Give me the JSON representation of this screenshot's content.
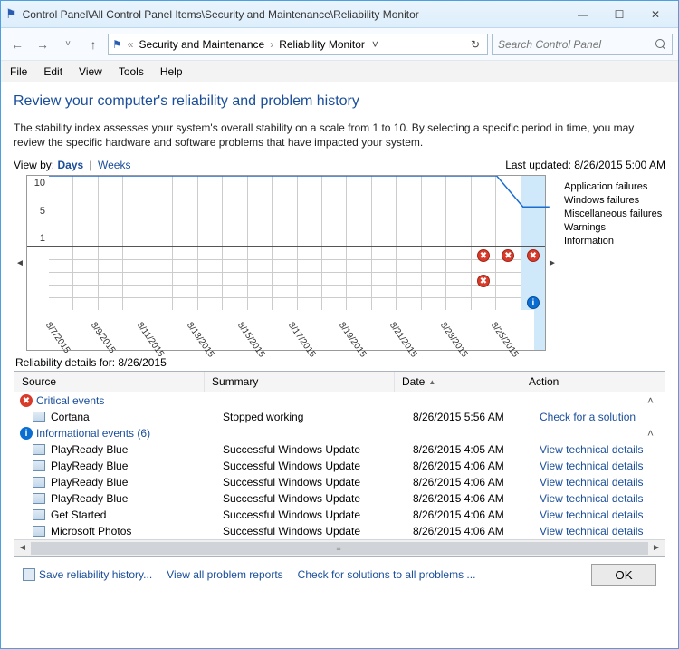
{
  "window": {
    "title": "Control Panel\\All Control Panel Items\\Security and Maintenance\\Reliability Monitor"
  },
  "breadcrumb": {
    "seg1": "Security and Maintenance",
    "seg2": "Reliability Monitor"
  },
  "search": {
    "placeholder": "Search Control Panel"
  },
  "menu": {
    "file": "File",
    "edit": "Edit",
    "view": "View",
    "tools": "Tools",
    "help": "Help"
  },
  "heading": "Review your computer's reliability and problem history",
  "description": "The stability index assesses your system's overall stability on a scale from 1 to 10. By selecting a specific period in time, you may review the specific hardware and software problems that have impacted your system.",
  "viewby": {
    "label": "View by:",
    "days": "Days",
    "weeks": "Weeks"
  },
  "last_updated": "Last updated: 8/26/2015 5:00 AM",
  "legend": {
    "app": "Application failures",
    "win": "Windows failures",
    "misc": "Miscellaneous failures",
    "warn": "Warnings",
    "info": "Information"
  },
  "details_for": "Reliability details for: 8/26/2015",
  "columns": {
    "source": "Source",
    "summary": "Summary",
    "date": "Date",
    "action": "Action"
  },
  "groups": {
    "critical": "Critical events",
    "informational": "Informational events (6)"
  },
  "rows": {
    "critical": [
      {
        "source": "Cortana",
        "summary": "Stopped working",
        "date": "8/26/2015 5:56 AM",
        "action": "Check for a solution"
      }
    ],
    "info": [
      {
        "source": "PlayReady Blue",
        "summary": "Successful Windows Update",
        "date": "8/26/2015 4:05 AM",
        "action": "View technical details"
      },
      {
        "source": "PlayReady Blue",
        "summary": "Successful Windows Update",
        "date": "8/26/2015 4:06 AM",
        "action": "View technical details"
      },
      {
        "source": "PlayReady Blue",
        "summary": "Successful Windows Update",
        "date": "8/26/2015 4:06 AM",
        "action": "View technical details"
      },
      {
        "source": "PlayReady Blue",
        "summary": "Successful Windows Update",
        "date": "8/26/2015 4:06 AM",
        "action": "View technical details"
      },
      {
        "source": "Get Started",
        "summary": "Successful Windows Update",
        "date": "8/26/2015 4:06 AM",
        "action": "View technical details"
      },
      {
        "source": "Microsoft Photos",
        "summary": "Successful Windows Update",
        "date": "8/26/2015 4:06 AM",
        "action": "View technical details"
      }
    ]
  },
  "footer": {
    "save": "Save reliability history...",
    "viewall": "View all problem reports",
    "check": "Check for solutions to all problems ...",
    "ok": "OK"
  },
  "chart_data": {
    "type": "line",
    "ylim": [
      1,
      10
    ],
    "yticks": [
      1,
      5,
      10
    ],
    "categories": [
      "8/7/2015",
      "8/9/2015",
      "8/11/2015",
      "8/13/2015",
      "8/15/2015",
      "8/17/2015",
      "8/19/2015",
      "8/21/2015",
      "8/23/2015",
      "8/25/2015"
    ],
    "stability_index": [
      10,
      10,
      10,
      10,
      10,
      10,
      10,
      10,
      10,
      10,
      10,
      10,
      10,
      10,
      10,
      10,
      10,
      10,
      6,
      6
    ],
    "events_per_day": {
      "17": {
        "application_failures": 1,
        "miscellaneous_failures": 1
      },
      "18": {
        "application_failures": 1
      },
      "19": {
        "application_failures": 1,
        "information": 1
      }
    },
    "selected_column_index": 19
  }
}
